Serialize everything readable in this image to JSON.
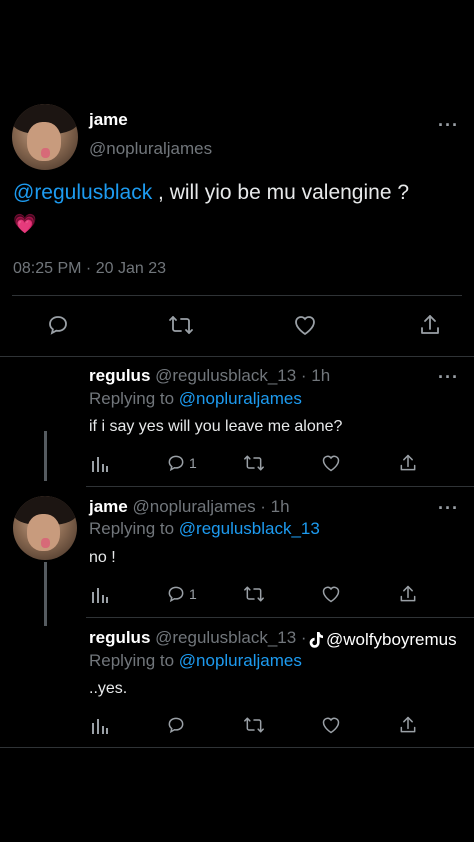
{
  "main_tweet": {
    "name": "jame",
    "handle": "@nopluraljames",
    "text_mention": "@regulusblack",
    "text_rest": " , will yio be mu valengine ?",
    "emoji": "💗",
    "timestamp": "08:25 PM · 20 Jan 23",
    "more_label": "···"
  },
  "replies": [
    {
      "name": "regulus",
      "meta": "@regulusblack_13 · 1h",
      "replying_prefix": "Replying to ",
      "replying_to": "@nopluraljames",
      "text": "if i say yes will you leave me alone?",
      "reply_count": "1",
      "more_label": "···"
    },
    {
      "name": "jame",
      "meta": "@nopluraljames · 1h",
      "replying_prefix": "Replying to ",
      "replying_to": "@regulusblack_13",
      "text": "no !",
      "reply_count": "1",
      "more_label": "···"
    },
    {
      "name": "regulus",
      "meta": "@regulusblack_13 · 1h",
      "replying_prefix": "Replying to ",
      "replying_to": "@nopluraljames",
      "text": "..yes.",
      "reply_count": "",
      "more_label": "···"
    }
  ],
  "watermark": {
    "icon": "tiktok-icon",
    "text": "@wolfyboyremus"
  },
  "colors": {
    "background": "#000000",
    "text": "#e7e9ea",
    "muted": "#71767b",
    "link": "#1d9bf0"
  }
}
